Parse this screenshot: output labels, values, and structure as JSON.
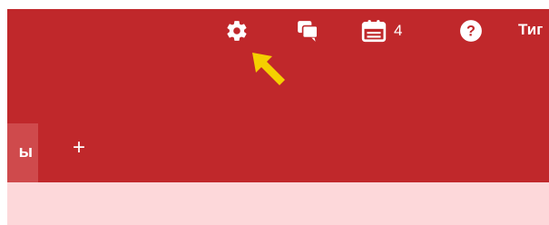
{
  "header": {
    "background": "#c0282b",
    "icons": {
      "settings": "gear-icon",
      "messages": "chat-icon",
      "calendar": "calendar-icon",
      "help": "help-icon"
    },
    "calendar_count": "4",
    "user_label": "Тиг"
  },
  "tabs": {
    "active_label_fragment": "ы",
    "add_label": "+"
  },
  "content": {
    "background": "#fdd8da"
  },
  "pointer": {
    "color": "#f5d000",
    "icon": "arrow-pointer-icon"
  }
}
